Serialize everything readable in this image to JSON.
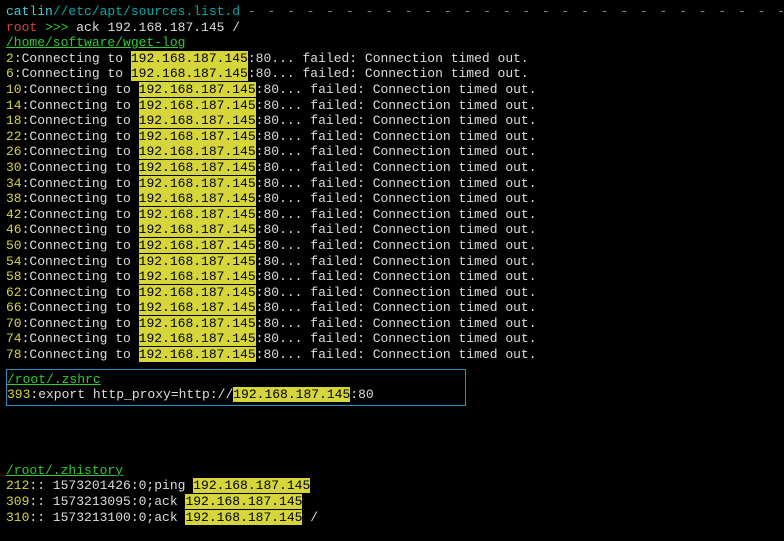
{
  "header": {
    "user": "catlin",
    "path": "/etc/apt/sources.list.d",
    "dashes": "- - - - - - - - - - - - - - - - - - - - - - - - - - - - - - - - - - - - - - - - -"
  },
  "prompt": {
    "user": "root",
    "marker": " >>> ",
    "command": "ack 192.168.187.145 /"
  },
  "file1": {
    "name": "/home/software/wget-log"
  },
  "connect_prefix": ":Connecting to ",
  "ip": "192.168.187.145",
  "connect_suffix": ":80... failed: Connection timed out.",
  "lines": [
    "2",
    "6",
    "10",
    "14",
    "18",
    "22",
    "26",
    "30",
    "34",
    "38",
    "42",
    "46",
    "50",
    "54",
    "58",
    "62",
    "66",
    "70",
    "74",
    "78"
  ],
  "file2": {
    "name": "/root/.zshrc",
    "line": "393",
    "prefix": ":export http_proxy=http://",
    "suffix": ":80"
  },
  "file3": {
    "name": "/root/.zhistory",
    "rows": [
      {
        "ln": "212",
        "prefix": ": 1573201426:0;ping "
      },
      {
        "ln": "309",
        "prefix": ": 1573213095:0;ack ",
        "suffix": ""
      },
      {
        "ln": "310",
        "prefix": ": 1573213100:0;ack ",
        "suffix": " /"
      }
    ]
  }
}
